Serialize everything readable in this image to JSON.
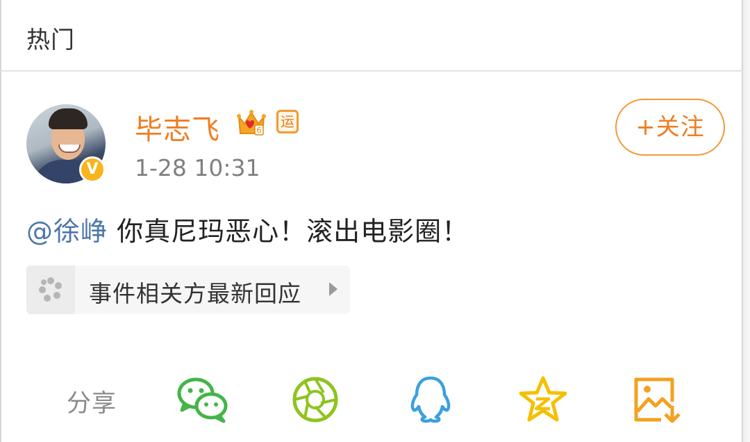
{
  "section": {
    "title": "热门"
  },
  "post": {
    "author": {
      "name": "毕志飞",
      "verified_mark": "V",
      "badges": [
        "crown-icon",
        "yun-icon"
      ],
      "yun_badge_text": "运"
    },
    "timestamp": "1-28 10:31",
    "follow_label": "+关注",
    "content": {
      "mention": "@徐峥",
      "text": " 你真尼玛恶心！滚出电影圈！"
    },
    "event_link": {
      "label": "事件相关方最新回应"
    }
  },
  "share": {
    "label": "分享",
    "targets": [
      {
        "icon": "wechat-icon"
      },
      {
        "icon": "moments-icon"
      },
      {
        "icon": "qq-icon"
      },
      {
        "icon": "qzone-icon"
      },
      {
        "icon": "save-image-icon"
      }
    ]
  },
  "colors": {
    "accent": "#ef7d22",
    "mention": "#4e77a8",
    "verified": "#f8b41c",
    "wechat": "#44b549",
    "moments": "#8fc31f",
    "qq": "#3aa0e0",
    "qzone": "#f5c000",
    "save_image": "#f3a120"
  }
}
